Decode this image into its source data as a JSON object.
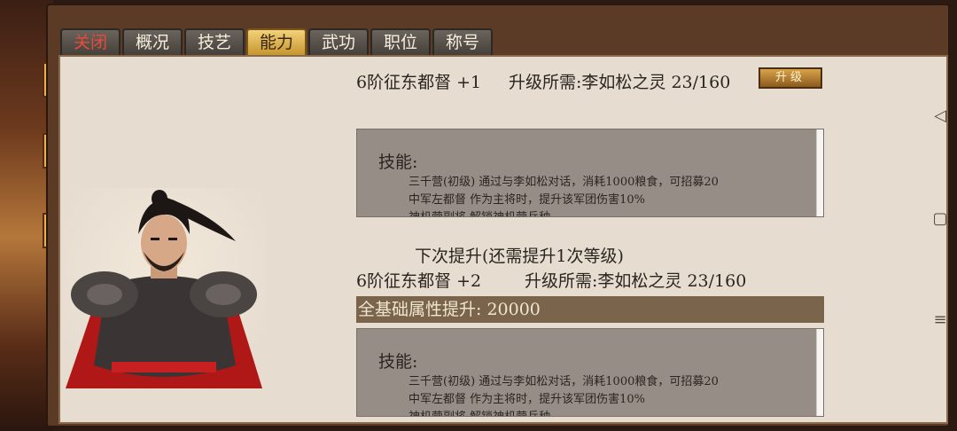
{
  "tabs": [
    {
      "label": "关闭",
      "kind": "close"
    },
    {
      "label": "概况"
    },
    {
      "label": "技艺"
    },
    {
      "label": "能力",
      "active": true
    },
    {
      "label": "武功"
    },
    {
      "label": "职位"
    },
    {
      "label": "称号"
    }
  ],
  "current": {
    "rank_text": "6阶征东都督 +1",
    "requirement_text": "升级所需:李如松之灵 23/160",
    "upgrade_label": "升级"
  },
  "skills_label": "技能:",
  "skills": [
    "三千营(初级)  通过与李如松对话，消耗1000粮食，可招募20",
    "中军左都督  作为主将时，提升该军团伤害10%",
    "神机营副将  解锁神机营兵种"
  ],
  "next": {
    "heading": "下次提升(还需提升1次等级)",
    "rank_text": "6阶征东都督 +2",
    "requirement_text": "升级所需:李如松之灵 23/160",
    "attr_text": "全基础属性提升: 20000"
  },
  "colors": {
    "panel_bg": "#e6ddd0",
    "skill_box": "#978d87",
    "attr_bar": "#7a644c",
    "active_tab": "#e0b24e",
    "close_red": "#e84a3a"
  },
  "system_nav": {
    "back": "◁",
    "home": "▢",
    "menu": "≡"
  }
}
